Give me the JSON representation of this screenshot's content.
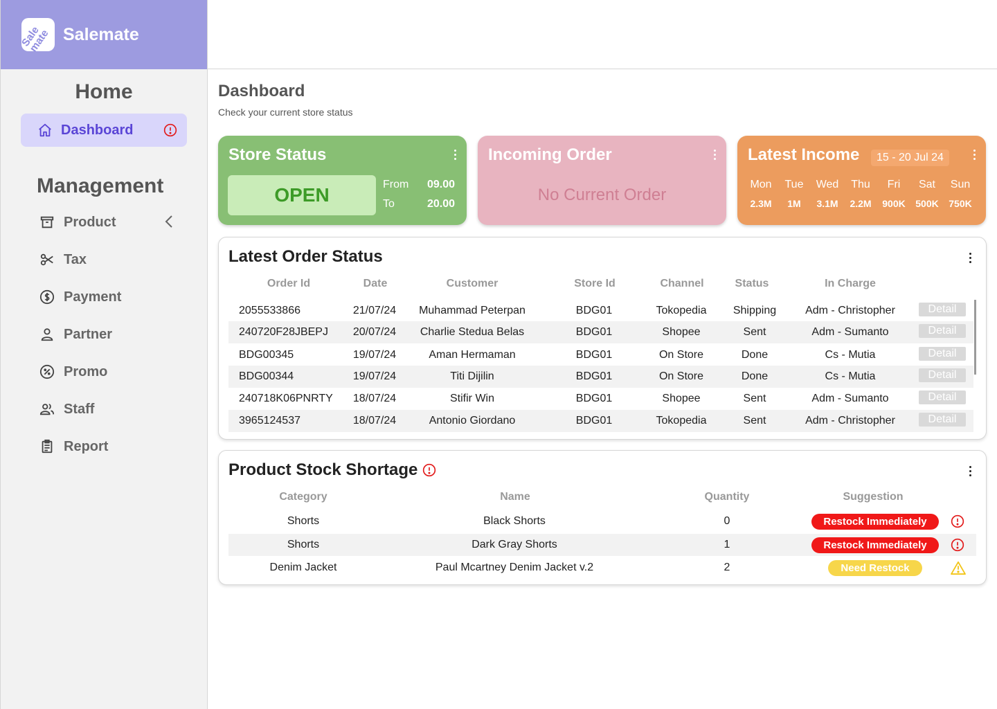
{
  "brand": {
    "logo_text": "Sale mate",
    "name": "Salemate",
    "color": "#9d9be0"
  },
  "sidebar": {
    "home_title": "Home",
    "active_item": {
      "label": "Dashboard",
      "icon": "home-icon",
      "alert_icon": "alert-circle-icon"
    },
    "management_title": "Management",
    "items": [
      {
        "label": "Product",
        "icon": "archive-box-icon",
        "has_chevron": true
      },
      {
        "label": "Tax",
        "icon": "scissors-icon"
      },
      {
        "label": "Payment",
        "icon": "dollar-circle-icon"
      },
      {
        "label": "Partner",
        "icon": "user-icon"
      },
      {
        "label": "Promo",
        "icon": "percent-badge-icon"
      },
      {
        "label": "Staff",
        "icon": "users-icon"
      },
      {
        "label": "Report",
        "icon": "clipboard-icon"
      }
    ]
  },
  "header": {
    "title": "Dashboard",
    "subtitle": "Check your current store status"
  },
  "store_status": {
    "title": "Store Status",
    "status": "OPEN",
    "from_label": "From",
    "from_value": "09.00",
    "to_label": "To",
    "to_value": "20.00",
    "color": "#88bf74"
  },
  "incoming_order": {
    "title": "Incoming Order",
    "message": "No Current Order",
    "color": "#e8b4c0"
  },
  "latest_income": {
    "title": "Latest Income",
    "date_range": "15 - 20 Jul 24",
    "color": "#ec9c5e",
    "days": [
      {
        "day": "Mon",
        "amount": "2.3M"
      },
      {
        "day": "Tue",
        "amount": "1M"
      },
      {
        "day": "Wed",
        "amount": "3.1M"
      },
      {
        "day": "Thu",
        "amount": "2.2M"
      },
      {
        "day": "Fri",
        "amount": "900K"
      },
      {
        "day": "Sat",
        "amount": "500K"
      },
      {
        "day": "Sun",
        "amount": "750K"
      }
    ]
  },
  "orders": {
    "title": "Latest Order Status",
    "columns": [
      "Order Id",
      "Date",
      "Customer",
      "Store Id",
      "Channel",
      "Status",
      "In Charge"
    ],
    "detail_label": "Detail",
    "rows": [
      {
        "id": "2055533866",
        "date": "21/07/24",
        "customer": "Muhammad Peterpan",
        "store": "BDG01",
        "channel": "Tokopedia",
        "status": "Shipping",
        "in_charge": "Adm - Christopher"
      },
      {
        "id": "240720F28JBEPJ",
        "date": "20/07/24",
        "customer": "Charlie Stedua Belas",
        "store": "BDG01",
        "channel": "Shopee",
        "status": "Sent",
        "in_charge": "Adm - Sumanto"
      },
      {
        "id": "BDG00345",
        "date": "19/07/24",
        "customer": "Aman Hermaman",
        "store": "BDG01",
        "channel": "On Store",
        "status": "Done",
        "in_charge": "Cs - Mutia"
      },
      {
        "id": "BDG00344",
        "date": "19/07/24",
        "customer": "Titi Dijilin",
        "store": "BDG01",
        "channel": "On Store",
        "status": "Done",
        "in_charge": "Cs - Mutia"
      },
      {
        "id": "240718K06PNRTY",
        "date": "18/07/24",
        "customer": "Stifir Win",
        "store": "BDG01",
        "channel": "Shopee",
        "status": "Sent",
        "in_charge": "Adm - Sumanto"
      },
      {
        "id": "3965124537",
        "date": "18/07/24",
        "customer": "Antonio Giordano",
        "store": "BDG01",
        "channel": "Tokopedia",
        "status": "Sent",
        "in_charge": "Adm - Christopher"
      }
    ]
  },
  "stock": {
    "title": "Product Stock Shortage",
    "columns": [
      "Category",
      "Name",
      "Quantity",
      "Suggestion"
    ],
    "rows": [
      {
        "category": "Shorts",
        "name": "Black Shorts",
        "quantity": "0",
        "suggestion": "Restock Immediately",
        "level": "critical",
        "icon": "alert-circle-icon"
      },
      {
        "category": "Shorts",
        "name": "Dark Gray Shorts",
        "quantity": "1",
        "suggestion": "Restock Immediately",
        "level": "critical",
        "icon": "alert-circle-icon"
      },
      {
        "category": "Denim Jacket",
        "name": "Paul Mcartney Denim Jacket v.2",
        "quantity": "2",
        "suggestion": "Need Restock",
        "level": "warning",
        "icon": "warning-triangle-icon"
      }
    ],
    "colors": {
      "critical": "#f01818",
      "warning": "#f7d64a"
    }
  }
}
